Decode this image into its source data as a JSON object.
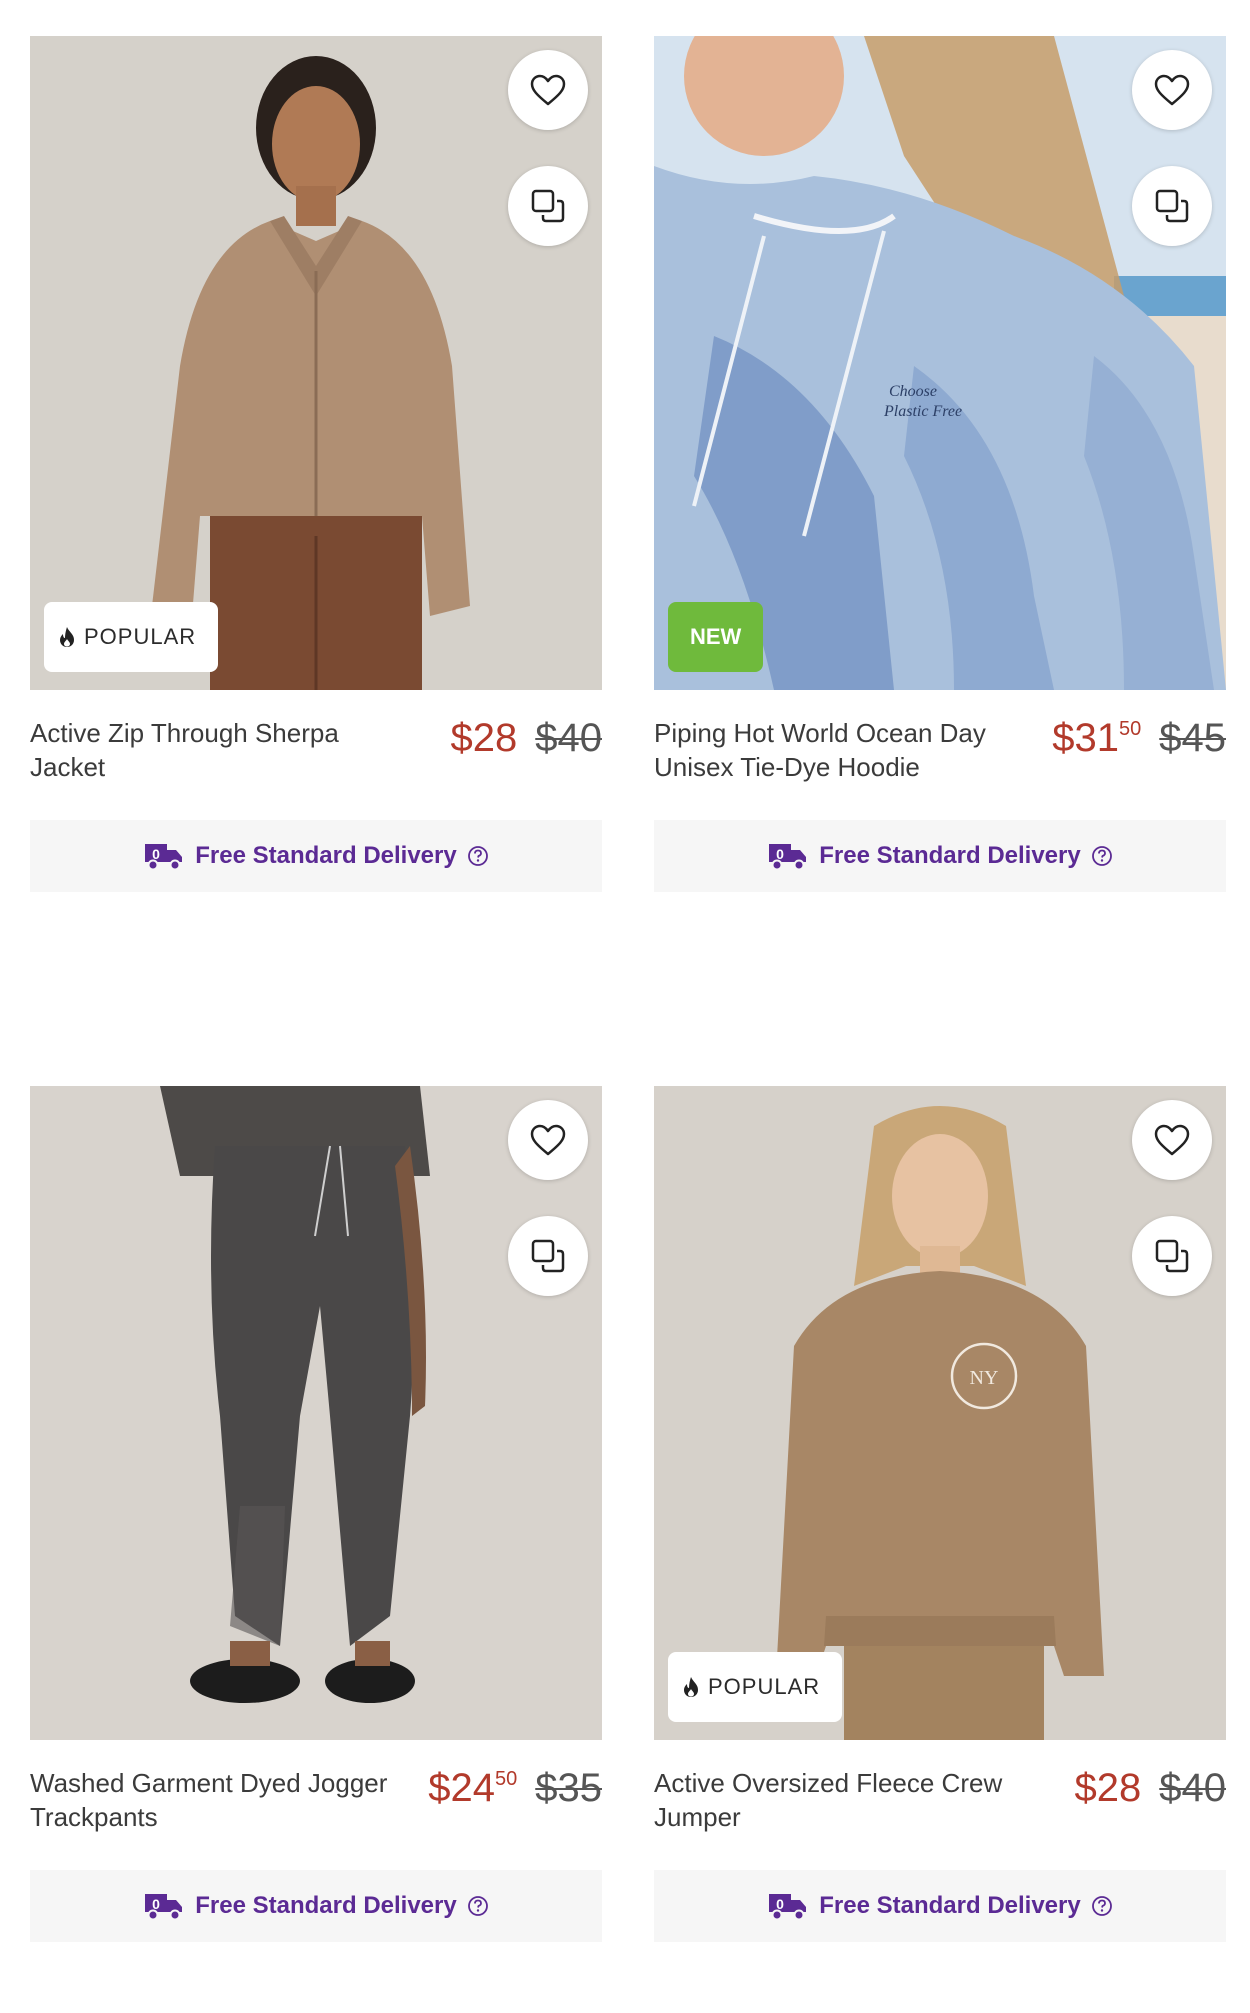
{
  "products": [
    {
      "title": "Active Zip Through Sherpa Jacket",
      "price_main": "$28",
      "price_cents": "",
      "price_was": "$40",
      "badge": "POPULAR",
      "badge_type": "popular",
      "delivery": "Free Standard Delivery"
    },
    {
      "title": "Piping Hot World Ocean Day Unisex Tie-Dye Hoodie",
      "price_main": "$31",
      "price_cents": "50",
      "price_was": "$45",
      "badge": "NEW",
      "badge_type": "new",
      "delivery": "Free Standard Delivery"
    },
    {
      "title": "Washed Garment Dyed Jogger Trackpants",
      "price_main": "$24",
      "price_cents": "50",
      "price_was": "$35",
      "badge": "",
      "badge_type": "",
      "delivery": "Free Standard Delivery"
    },
    {
      "title": "Active Oversized Fleece Crew Jumper",
      "price_main": "$28",
      "price_cents": "",
      "price_was": "$40",
      "badge": "POPULAR",
      "badge_type": "popular",
      "delivery": "Free Standard Delivery"
    }
  ],
  "colors": {
    "sale_price": "#b23a2b",
    "delivery_text": "#5b2a94",
    "new_badge": "#6fba3c"
  },
  "icons": {
    "favourite": "heart-icon",
    "compare": "compare-icon",
    "popular": "flame-icon",
    "delivery": "delivery-truck-icon",
    "help": "question-circle-icon"
  }
}
